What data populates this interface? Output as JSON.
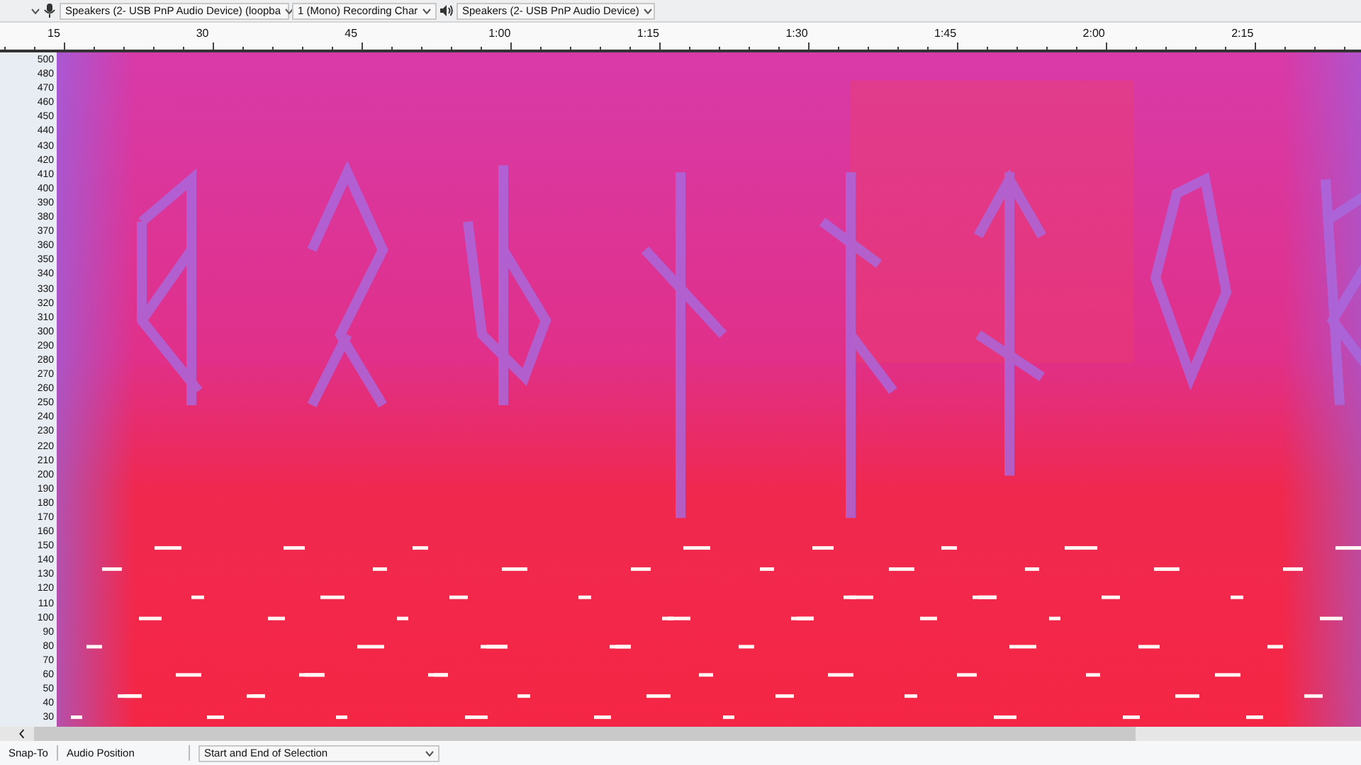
{
  "toolbar": {
    "recording_device": "Speakers (2- USB PnP Audio Device) (loopba",
    "recording_channels": "1 (Mono) Recording Char",
    "playback_device": "Speakers (2- USB PnP Audio Device)"
  },
  "timeline": {
    "labels": [
      "15",
      "30",
      "45",
      "1:00",
      "1:15",
      "1:30",
      "1:45",
      "2:00",
      "2:15"
    ]
  },
  "spectrogram": {
    "frequency_labels": [
      "500",
      "480",
      "470",
      "460",
      "450",
      "440",
      "430",
      "420",
      "410",
      "400",
      "390",
      "380",
      "370",
      "360",
      "350",
      "340",
      "330",
      "320",
      "310",
      "300",
      "290",
      "280",
      "270",
      "260",
      "250",
      "240",
      "230",
      "220",
      "210",
      "200",
      "190",
      "180",
      "170",
      "160",
      "150",
      "140",
      "130",
      "120",
      "110",
      "100",
      "90",
      "80",
      "70",
      "60",
      "50",
      "40",
      "30"
    ]
  },
  "selection_toolbar": {
    "snap_to": "Snap-To",
    "audio_position": "Audio Position",
    "selection_format": "Start and End of Selection"
  }
}
